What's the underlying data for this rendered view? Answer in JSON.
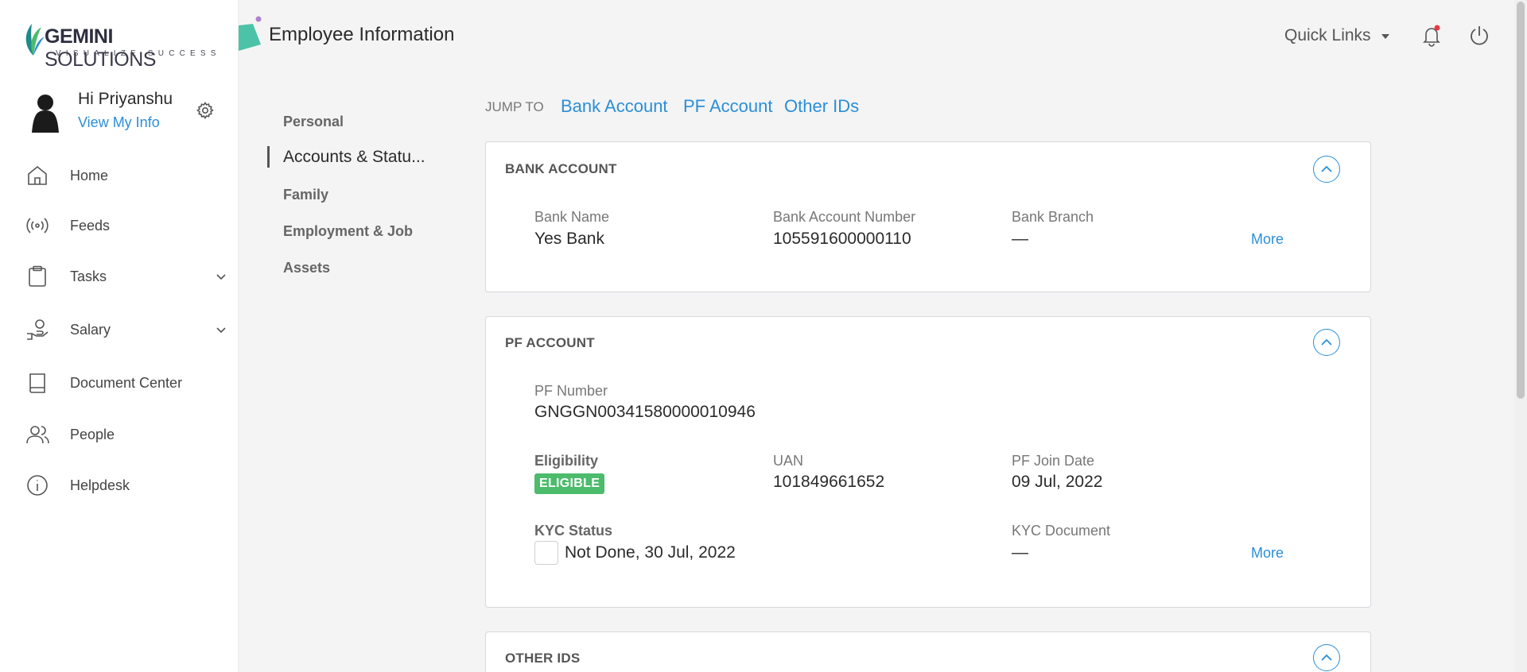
{
  "brand": {
    "name_bold": "GEMINI",
    "name_rest": " SOLUTIONS",
    "tagline": "VISUALIZE SUCCESS",
    "accent": "#2a8fd8"
  },
  "user": {
    "greeting": "Hi Priyanshu",
    "view_info": "View My Info"
  },
  "sidebar": {
    "items": [
      {
        "label": "Home",
        "icon": "home-icon"
      },
      {
        "label": "Feeds",
        "icon": "feeds-icon"
      },
      {
        "label": "Tasks",
        "icon": "clipboard-icon"
      },
      {
        "label": "Salary",
        "icon": "salary-icon"
      },
      {
        "label": "Document Center",
        "icon": "book-icon"
      },
      {
        "label": "People",
        "icon": "people-icon"
      },
      {
        "label": "Helpdesk",
        "icon": "info-icon"
      }
    ]
  },
  "header": {
    "title": "Employee Information",
    "quick_links": "Quick Links"
  },
  "subnav": {
    "items": [
      "Personal",
      "Accounts & Statu...",
      "Family",
      "Employment & Job",
      "Assets"
    ]
  },
  "jump": {
    "label": "JUMP TO",
    "links": [
      "Bank Account",
      "PF Account",
      "Other IDs"
    ]
  },
  "bank": {
    "title": "BANK ACCOUNT",
    "bank_name_label": "Bank Name",
    "bank_name": "Yes Bank",
    "acct_label": "Bank Account Number",
    "acct": "105591600000110",
    "branch_label": "Bank Branch",
    "branch": "—",
    "more": "More"
  },
  "pf": {
    "title": "PF ACCOUNT",
    "pf_number_label": "PF Number",
    "pf_number": "GNGGN00341580000010946",
    "eligibility_label": "Eligibility",
    "eligibility": "ELIGIBLE",
    "uan_label": "UAN",
    "uan": "101849661652",
    "join_label": "PF Join Date",
    "join": "09 Jul, 2022",
    "kyc_label": "KYC Status",
    "kyc": "Not Done, 30 Jul, 2022",
    "kyc_doc_label": "KYC Document",
    "kyc_doc": "—",
    "more": "More"
  },
  "other": {
    "title": "OTHER IDS"
  }
}
